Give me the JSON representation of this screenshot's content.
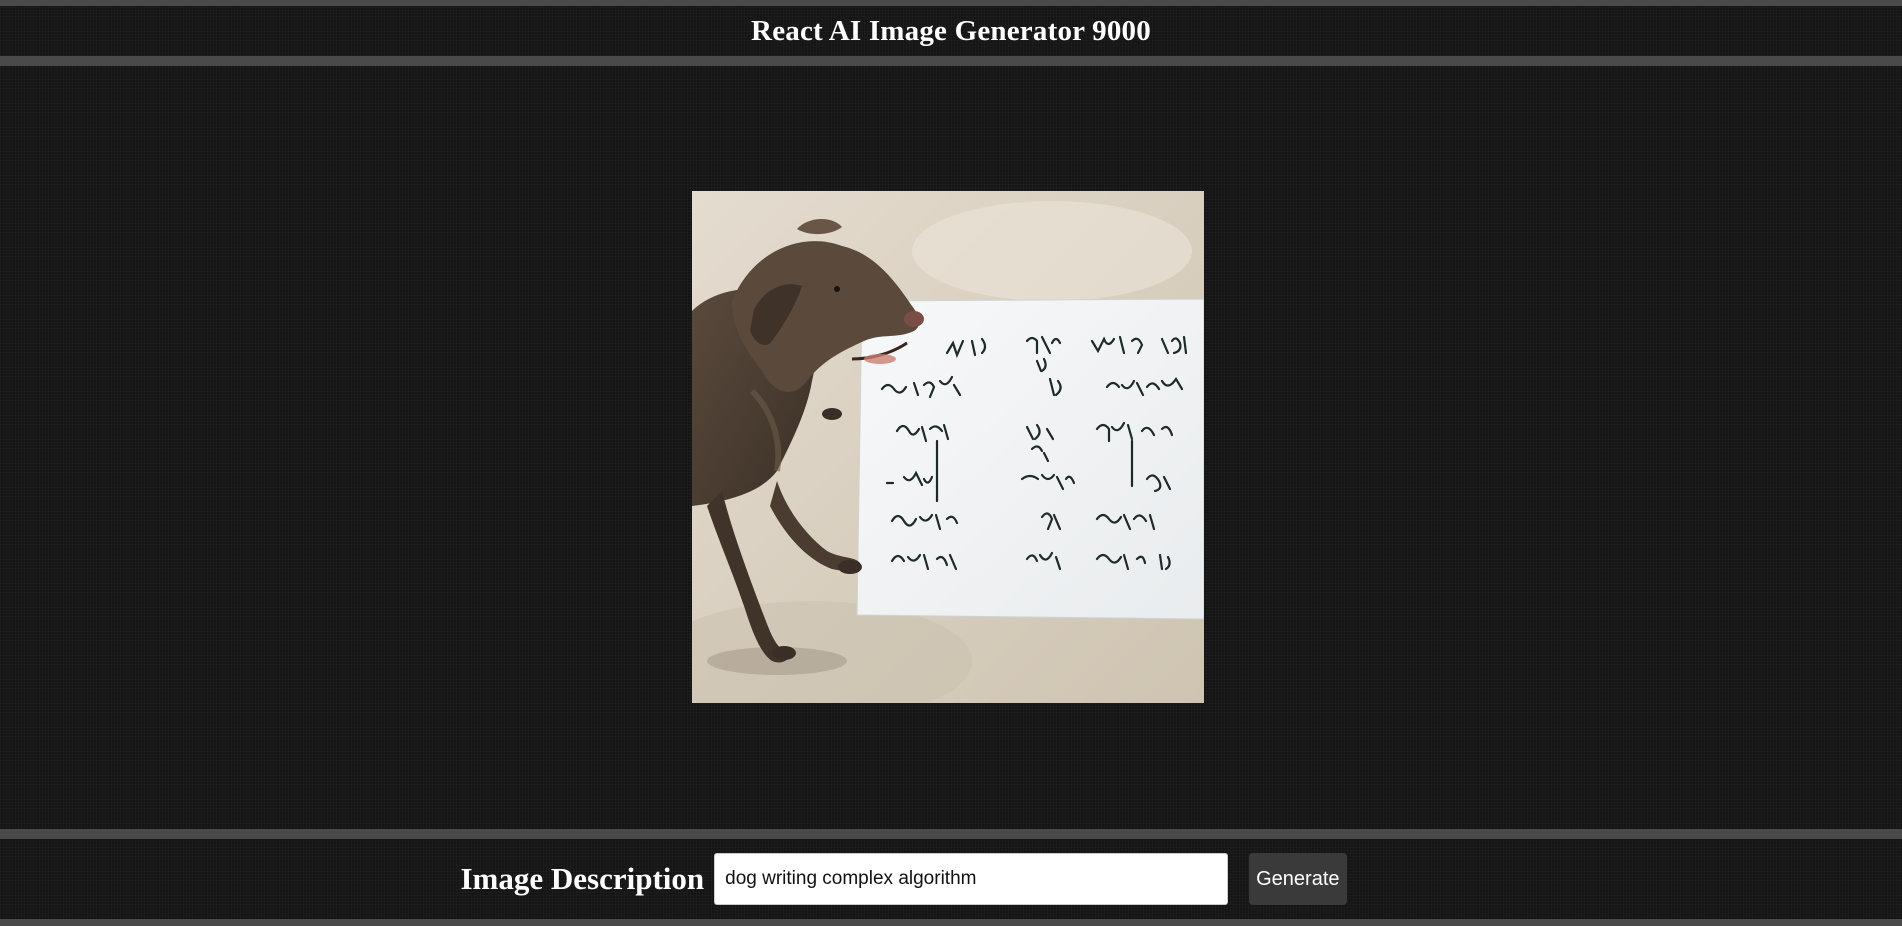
{
  "app": {
    "title": "React AI Image Generator 9000"
  },
  "main": {
    "image_alt": "dog writing complex algorithm"
  },
  "footer": {
    "label": "Image Description",
    "input_value": "dog writing complex algorithm",
    "button_label": "Generate"
  },
  "colors": {
    "background": "#151515",
    "divider": "#4a4a4a",
    "button_bg": "#3a3a3a",
    "text": "#ffffff"
  }
}
